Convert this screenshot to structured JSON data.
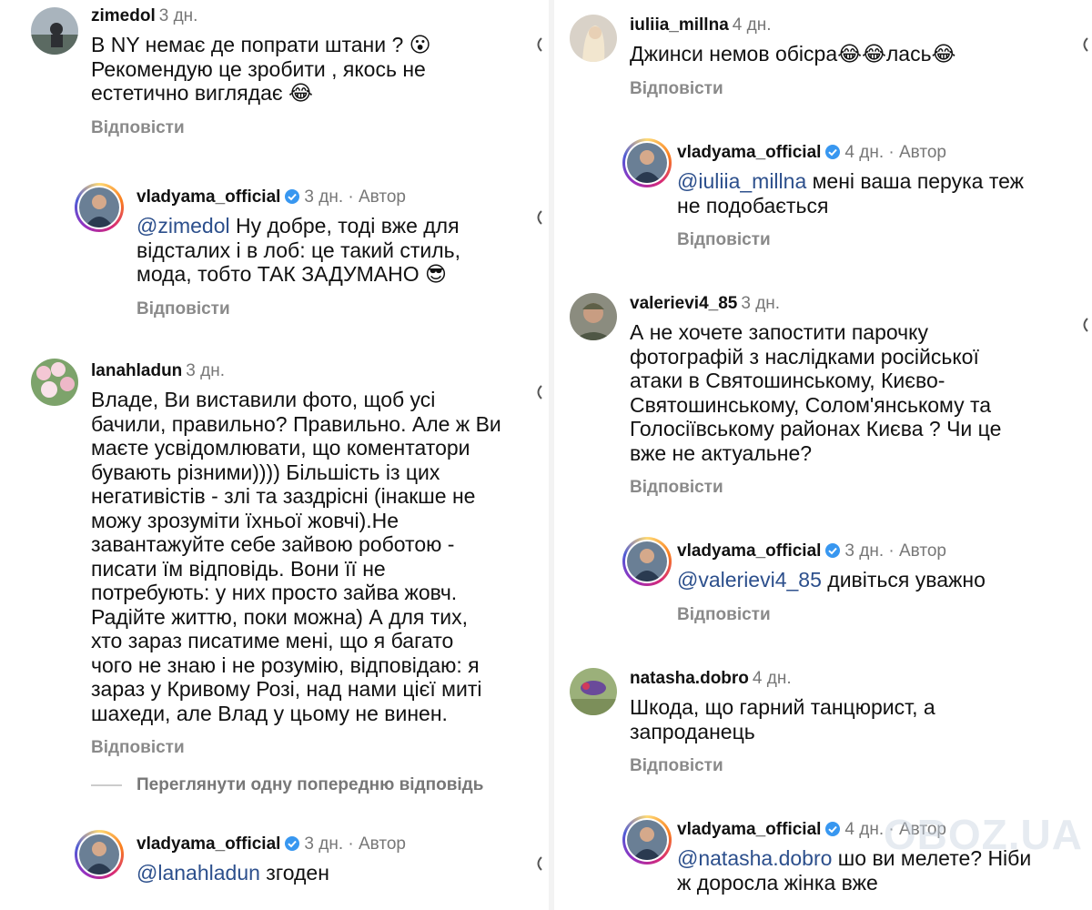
{
  "left": {
    "c1": {
      "user": "zimedol",
      "time": "3 дн.",
      "text": "В NY немає де попрати штани ? 😮\nРекомендую це зробити , якось не\nестетично виглядає 😂",
      "reply": "Відповісти"
    },
    "r1": {
      "user": "vladyama_official",
      "time": "3 дн. · Автор",
      "mention": "@zimedol",
      "text": " Ну добре, тоді вже для\nвідсталих і в лоб: це такий стиль,\nмода, тобто ТАК ЗАДУМАНО 😎",
      "reply": "Відповісти"
    },
    "c2": {
      "user": "lanahladun",
      "time": "3 дн.",
      "text": "Владе, Ви виставили фото, щоб усі\nбачили, правильно? Правильно. Але ж Ви\nмаєте усвідомлювати, що коментатори\nбувають різними)))) Більшість із цих\nнегативістів - злі та заздрісні (інакше не\nможу зрозуміти їхньої жовчі).Не\nзавантажуйте себе зайвою роботою -\nписати їм відповідь. Вони її не\nпотребують: у них просто зайва жовч.\nРадійте життю, поки можна) А для тих,\nхто зараз писатиме мені, що я багато\nчого не знаю і не розумію, відповідаю: я\nзараз у Кривому Розі, над нами цієї миті\nшахеди, але Влад у цьому не винен.",
      "reply": "Відповісти"
    },
    "view_previous": "Переглянути одну попередню відповідь",
    "r2": {
      "user": "vladyama_official",
      "time": "3 дн. · Автор",
      "mention": "@lanahladun",
      "text": " згоден"
    }
  },
  "right": {
    "c1": {
      "user": "iuliia_millna",
      "time": "4 дн.",
      "text": "Джинси немов обісра😂😂лась😂",
      "reply": "Відповісти"
    },
    "r1": {
      "user": "vladyama_official",
      "time": "4 дн. · Автор",
      "mention": "@iuliia_millna",
      "text": " мені ваша перука теж\nне подобається",
      "reply": "Відповісти"
    },
    "c2": {
      "user": "valerievi4_85",
      "time": "3 дн.",
      "text": "А не хочете запостити парочку\nфотографій з наслідками російської\nатаки в Святошинському, Києво-\nСвятошинському, Солом'янському та\nГолосіївському районах Києва ? Чи це\nвже не актуальне?",
      "reply": "Відповісти"
    },
    "r2": {
      "user": "vladyama_official",
      "time": "3 дн. · Автор",
      "mention": "@valerievi4_85",
      "text": " дивіться уважно",
      "reply": "Відповісти"
    },
    "c3": {
      "user": "natasha.dobro",
      "time": "4 дн.",
      "text": "Шкода, що гарний танцюрист, а\nзапроданець",
      "reply": "Відповісти"
    },
    "r3": {
      "user": "vladyama_official",
      "time": "4 дн. · Автор",
      "mention": "@natasha.dobro",
      "text": " шо ви мелете? Ніби\nж доросла жінка вже"
    }
  },
  "watermark": "OBOZ.UA",
  "colors": {
    "mention": "#2c4f8c",
    "verified": "#3897f0",
    "muted": "#8a8a8a"
  },
  "icons": {
    "verified": "verified-badge-icon",
    "like": "heart-icon"
  }
}
